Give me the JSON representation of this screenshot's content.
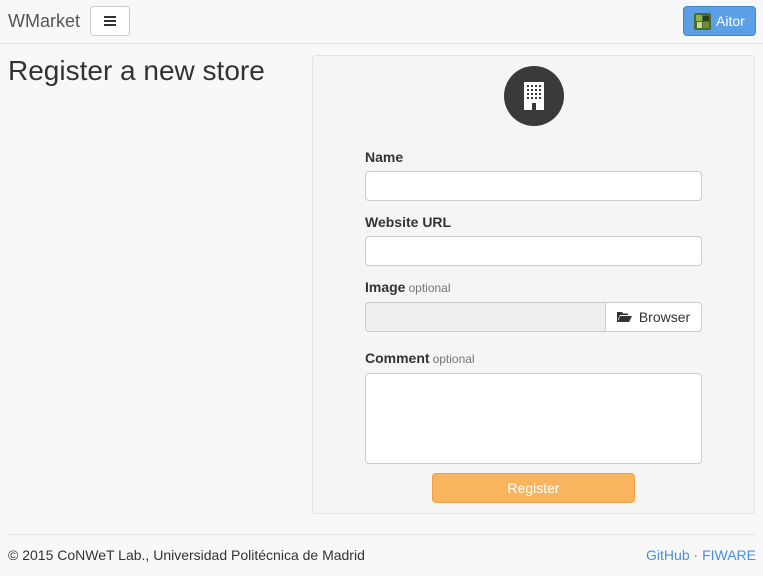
{
  "navbar": {
    "brand": "WMarket",
    "menu_icon": "hamburger-icon",
    "user_name": "Aitor",
    "user_avatar": "avatar-image"
  },
  "page": {
    "title": "Register a new store"
  },
  "form": {
    "header_icon": "building-icon",
    "name_label": "Name",
    "name_value": "",
    "website_label": "Website URL",
    "website_value": "",
    "image_label": "Image",
    "image_optional": "optional",
    "browse_label": "Browser",
    "browse_icon": "folder-open-icon",
    "comment_label": "Comment",
    "comment_optional": "optional",
    "comment_value": "",
    "register_label": "Register"
  },
  "footer": {
    "copyright": "© 2015 CoNWeT Lab., Universidad Politécnica de Madrid",
    "link_github": "GitHub",
    "separator": "·",
    "link_fiware": "FIWARE"
  },
  "colors": {
    "register_button": "#f9b55e",
    "user_button": "#5ba0e6",
    "link": "#4a90e2"
  }
}
